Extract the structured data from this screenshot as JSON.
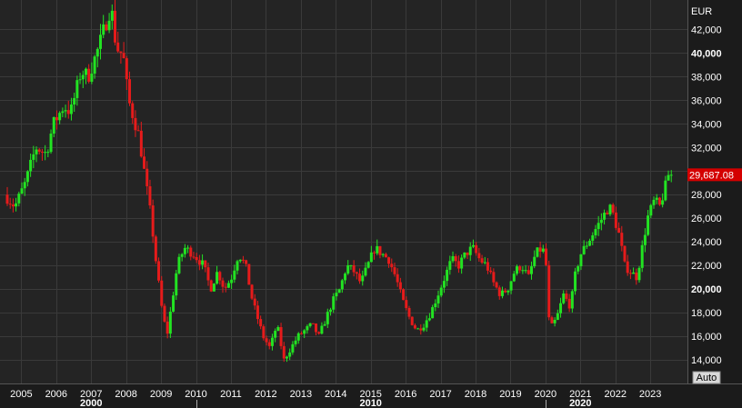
{
  "currency_label": "EUR",
  "last_price_label": "29,687.08",
  "auto_label": "Auto",
  "colors": {
    "background": "#1b1b1b",
    "plot_background": "#242424",
    "grid": "#3a3a3a",
    "up": "#22e322",
    "down": "#e61b1b",
    "axis_text": "#ffffff",
    "price_tag": "#d40000"
  },
  "chart_data": {
    "type": "candlestick",
    "title": "",
    "ylim": [
      12000,
      44500
    ],
    "xlim": [
      2004.6,
      2023.75
    ],
    "grid": true,
    "y_ticks": [
      14000,
      16000,
      18000,
      20000,
      22000,
      24000,
      26000,
      28000,
      32000,
      34000,
      36000,
      38000,
      40000,
      42000
    ],
    "y_tick_labels": [
      "14,000",
      "16,000",
      "18,000",
      "20,000",
      "22,000",
      "24,000",
      "26,000",
      "28,000",
      "32,000",
      "34,000",
      "36,000",
      "38,000",
      "40,000",
      "42,000"
    ],
    "bold_y_ticks": [
      20000,
      40000
    ],
    "x_ticks": [
      2005,
      2006,
      2007,
      2008,
      2009,
      2010,
      2011,
      2012,
      2013,
      2014,
      2015,
      2016,
      2017,
      2018,
      2019,
      2020,
      2021,
      2022,
      2023
    ],
    "x_tick_labels": [
      "2005",
      "2006",
      "2007",
      "2008",
      "2009",
      "2010",
      "2011",
      "2012",
      "2013",
      "2014",
      "2015",
      "2016",
      "2017",
      "2018",
      "2019",
      "2020",
      "2021",
      "2022",
      "2023"
    ],
    "decades": [
      {
        "label": "2000",
        "x": 2007
      },
      {
        "label": "2010",
        "x": 2015
      },
      {
        "label": "2020",
        "x": 2021
      }
    ],
    "last_price": 29687.08,
    "candle_interval": "month",
    "anchors": [
      [
        2004.6,
        28000
      ],
      [
        2004.9,
        27000
      ],
      [
        2005.2,
        29000
      ],
      [
        2005.5,
        32000
      ],
      [
        2005.8,
        31500
      ],
      [
        2006.0,
        34000
      ],
      [
        2006.3,
        35500
      ],
      [
        2006.5,
        35000
      ],
      [
        2006.8,
        38500
      ],
      [
        2007.0,
        38000
      ],
      [
        2007.3,
        40500
      ],
      [
        2007.5,
        42500
      ],
      [
        2007.65,
        44000
      ],
      [
        2007.8,
        40500
      ],
      [
        2008.0,
        39800
      ],
      [
        2008.15,
        36000
      ],
      [
        2008.3,
        34500
      ],
      [
        2008.45,
        33000
      ],
      [
        2008.6,
        30000
      ],
      [
        2008.8,
        26000
      ],
      [
        2008.95,
        22000
      ],
      [
        2009.1,
        18500
      ],
      [
        2009.25,
        16000
      ],
      [
        2009.4,
        19000
      ],
      [
        2009.55,
        22000
      ],
      [
        2009.75,
        23500
      ],
      [
        2010.0,
        23000
      ],
      [
        2010.3,
        22000
      ],
      [
        2010.5,
        20000
      ],
      [
        2010.7,
        21500
      ],
      [
        2010.9,
        20000
      ],
      [
        2011.1,
        21000
      ],
      [
        2011.3,
        23000
      ],
      [
        2011.5,
        22000
      ],
      [
        2011.7,
        19000
      ],
      [
        2011.9,
        17000
      ],
      [
        2012.0,
        16000
      ],
      [
        2012.2,
        15000
      ],
      [
        2012.4,
        17000
      ],
      [
        2012.6,
        14000
      ],
      [
        2012.8,
        15000
      ],
      [
        2013.0,
        16000
      ],
      [
        2013.2,
        16500
      ],
      [
        2013.4,
        17000
      ],
      [
        2013.6,
        16000
      ],
      [
        2013.8,
        17500
      ],
      [
        2014.0,
        19000
      ],
      [
        2014.2,
        20000
      ],
      [
        2014.4,
        22000
      ],
      [
        2014.6,
        21500
      ],
      [
        2014.8,
        20500
      ],
      [
        2015.0,
        22000
      ],
      [
        2015.2,
        23500
      ],
      [
        2015.4,
        23000
      ],
      [
        2015.6,
        22500
      ],
      [
        2015.8,
        21000
      ],
      [
        2016.0,
        19000
      ],
      [
        2016.2,
        17500
      ],
      [
        2016.4,
        16500
      ],
      [
        2016.6,
        17000
      ],
      [
        2016.8,
        18000
      ],
      [
        2017.0,
        19500
      ],
      [
        2017.2,
        21000
      ],
      [
        2017.4,
        22500
      ],
      [
        2017.6,
        22000
      ],
      [
        2017.8,
        23000
      ],
      [
        2018.0,
        23500
      ],
      [
        2018.2,
        22500
      ],
      [
        2018.4,
        22000
      ],
      [
        2018.6,
        20500
      ],
      [
        2018.8,
        19500
      ],
      [
        2019.0,
        20000
      ],
      [
        2019.2,
        21500
      ],
      [
        2019.4,
        22000
      ],
      [
        2019.6,
        21000
      ],
      [
        2019.8,
        23000
      ],
      [
        2020.0,
        23500
      ],
      [
        2020.1,
        22000
      ],
      [
        2020.2,
        16500
      ],
      [
        2020.4,
        17500
      ],
      [
        2020.6,
        19500
      ],
      [
        2020.8,
        18500
      ],
      [
        2020.95,
        21500
      ],
      [
        2021.1,
        23000
      ],
      [
        2021.3,
        24000
      ],
      [
        2021.5,
        25000
      ],
      [
        2021.7,
        26000
      ],
      [
        2021.9,
        27000
      ],
      [
        2022.0,
        26500
      ],
      [
        2022.2,
        24500
      ],
      [
        2022.35,
        22000
      ],
      [
        2022.5,
        21500
      ],
      [
        2022.7,
        21000
      ],
      [
        2022.85,
        23500
      ],
      [
        2023.0,
        26000
      ],
      [
        2023.2,
        27500
      ],
      [
        2023.35,
        27000
      ],
      [
        2023.5,
        28500
      ],
      [
        2023.6,
        29687
      ]
    ]
  }
}
